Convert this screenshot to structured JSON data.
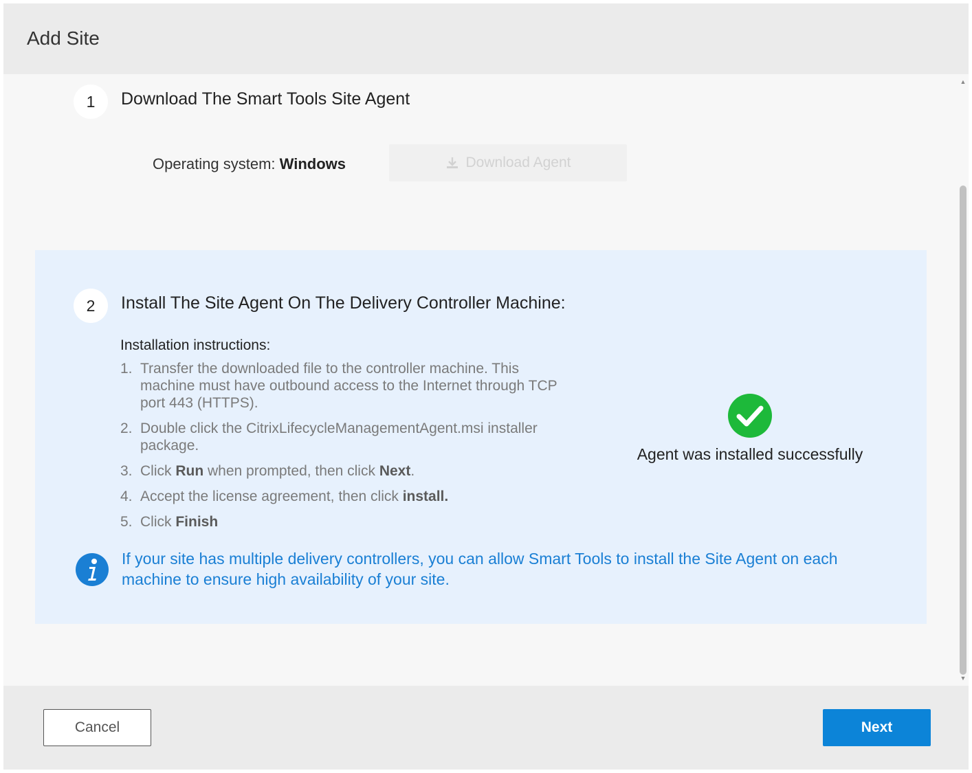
{
  "dialog": {
    "title": "Add Site"
  },
  "step1": {
    "number": "1",
    "title": "Download The Smart Tools Site Agent",
    "os_label": "Operating system:",
    "os_value": "Windows",
    "download_button": "Download Agent"
  },
  "step2": {
    "number": "2",
    "title": "Install The Site Agent On The Delivery Controller Machine:",
    "instructions_heading": "Installation instructions:",
    "instructions": [
      {
        "num": "1.",
        "pre": "Transfer the downloaded file to the controller machine. This machine must have outbound access to the Internet through TCP port 443 (HTTPS).",
        "b1": "",
        "mid": "",
        "b2": "",
        "post": ""
      },
      {
        "num": "2.",
        "pre": "Double click the CitrixLifecycleManagementAgent.msi installer package.",
        "b1": "",
        "mid": "",
        "b2": "",
        "post": ""
      },
      {
        "num": "3.",
        "pre": "Click ",
        "b1": "Run",
        "mid": " when prompted, then click ",
        "b2": "Next",
        "post": "."
      },
      {
        "num": "4.",
        "pre": "Accept the license agreement, then click ",
        "b1": "install.",
        "mid": "",
        "b2": "",
        "post": ""
      },
      {
        "num": "5.",
        "pre": "Click ",
        "b1": "Finish",
        "mid": "",
        "b2": "",
        "post": ""
      }
    ],
    "success_message": "Agent was installed successfully",
    "info_note": "If your site has multiple delivery controllers, you can allow Smart Tools to install the Site Agent on each machine to ensure high availability of your site."
  },
  "footer": {
    "cancel_label": "Cancel",
    "next_label": "Next"
  },
  "icons": {
    "download": "download-icon",
    "success": "check-circle-icon",
    "info": "info-icon",
    "scroll_up": "chevron-up-icon",
    "scroll_down": "chevron-down-icon"
  },
  "colors": {
    "accent": "#0c84d8",
    "success": "#1db93a",
    "info_text": "#1a7fd4",
    "info_panel": "#e7f1fd"
  }
}
